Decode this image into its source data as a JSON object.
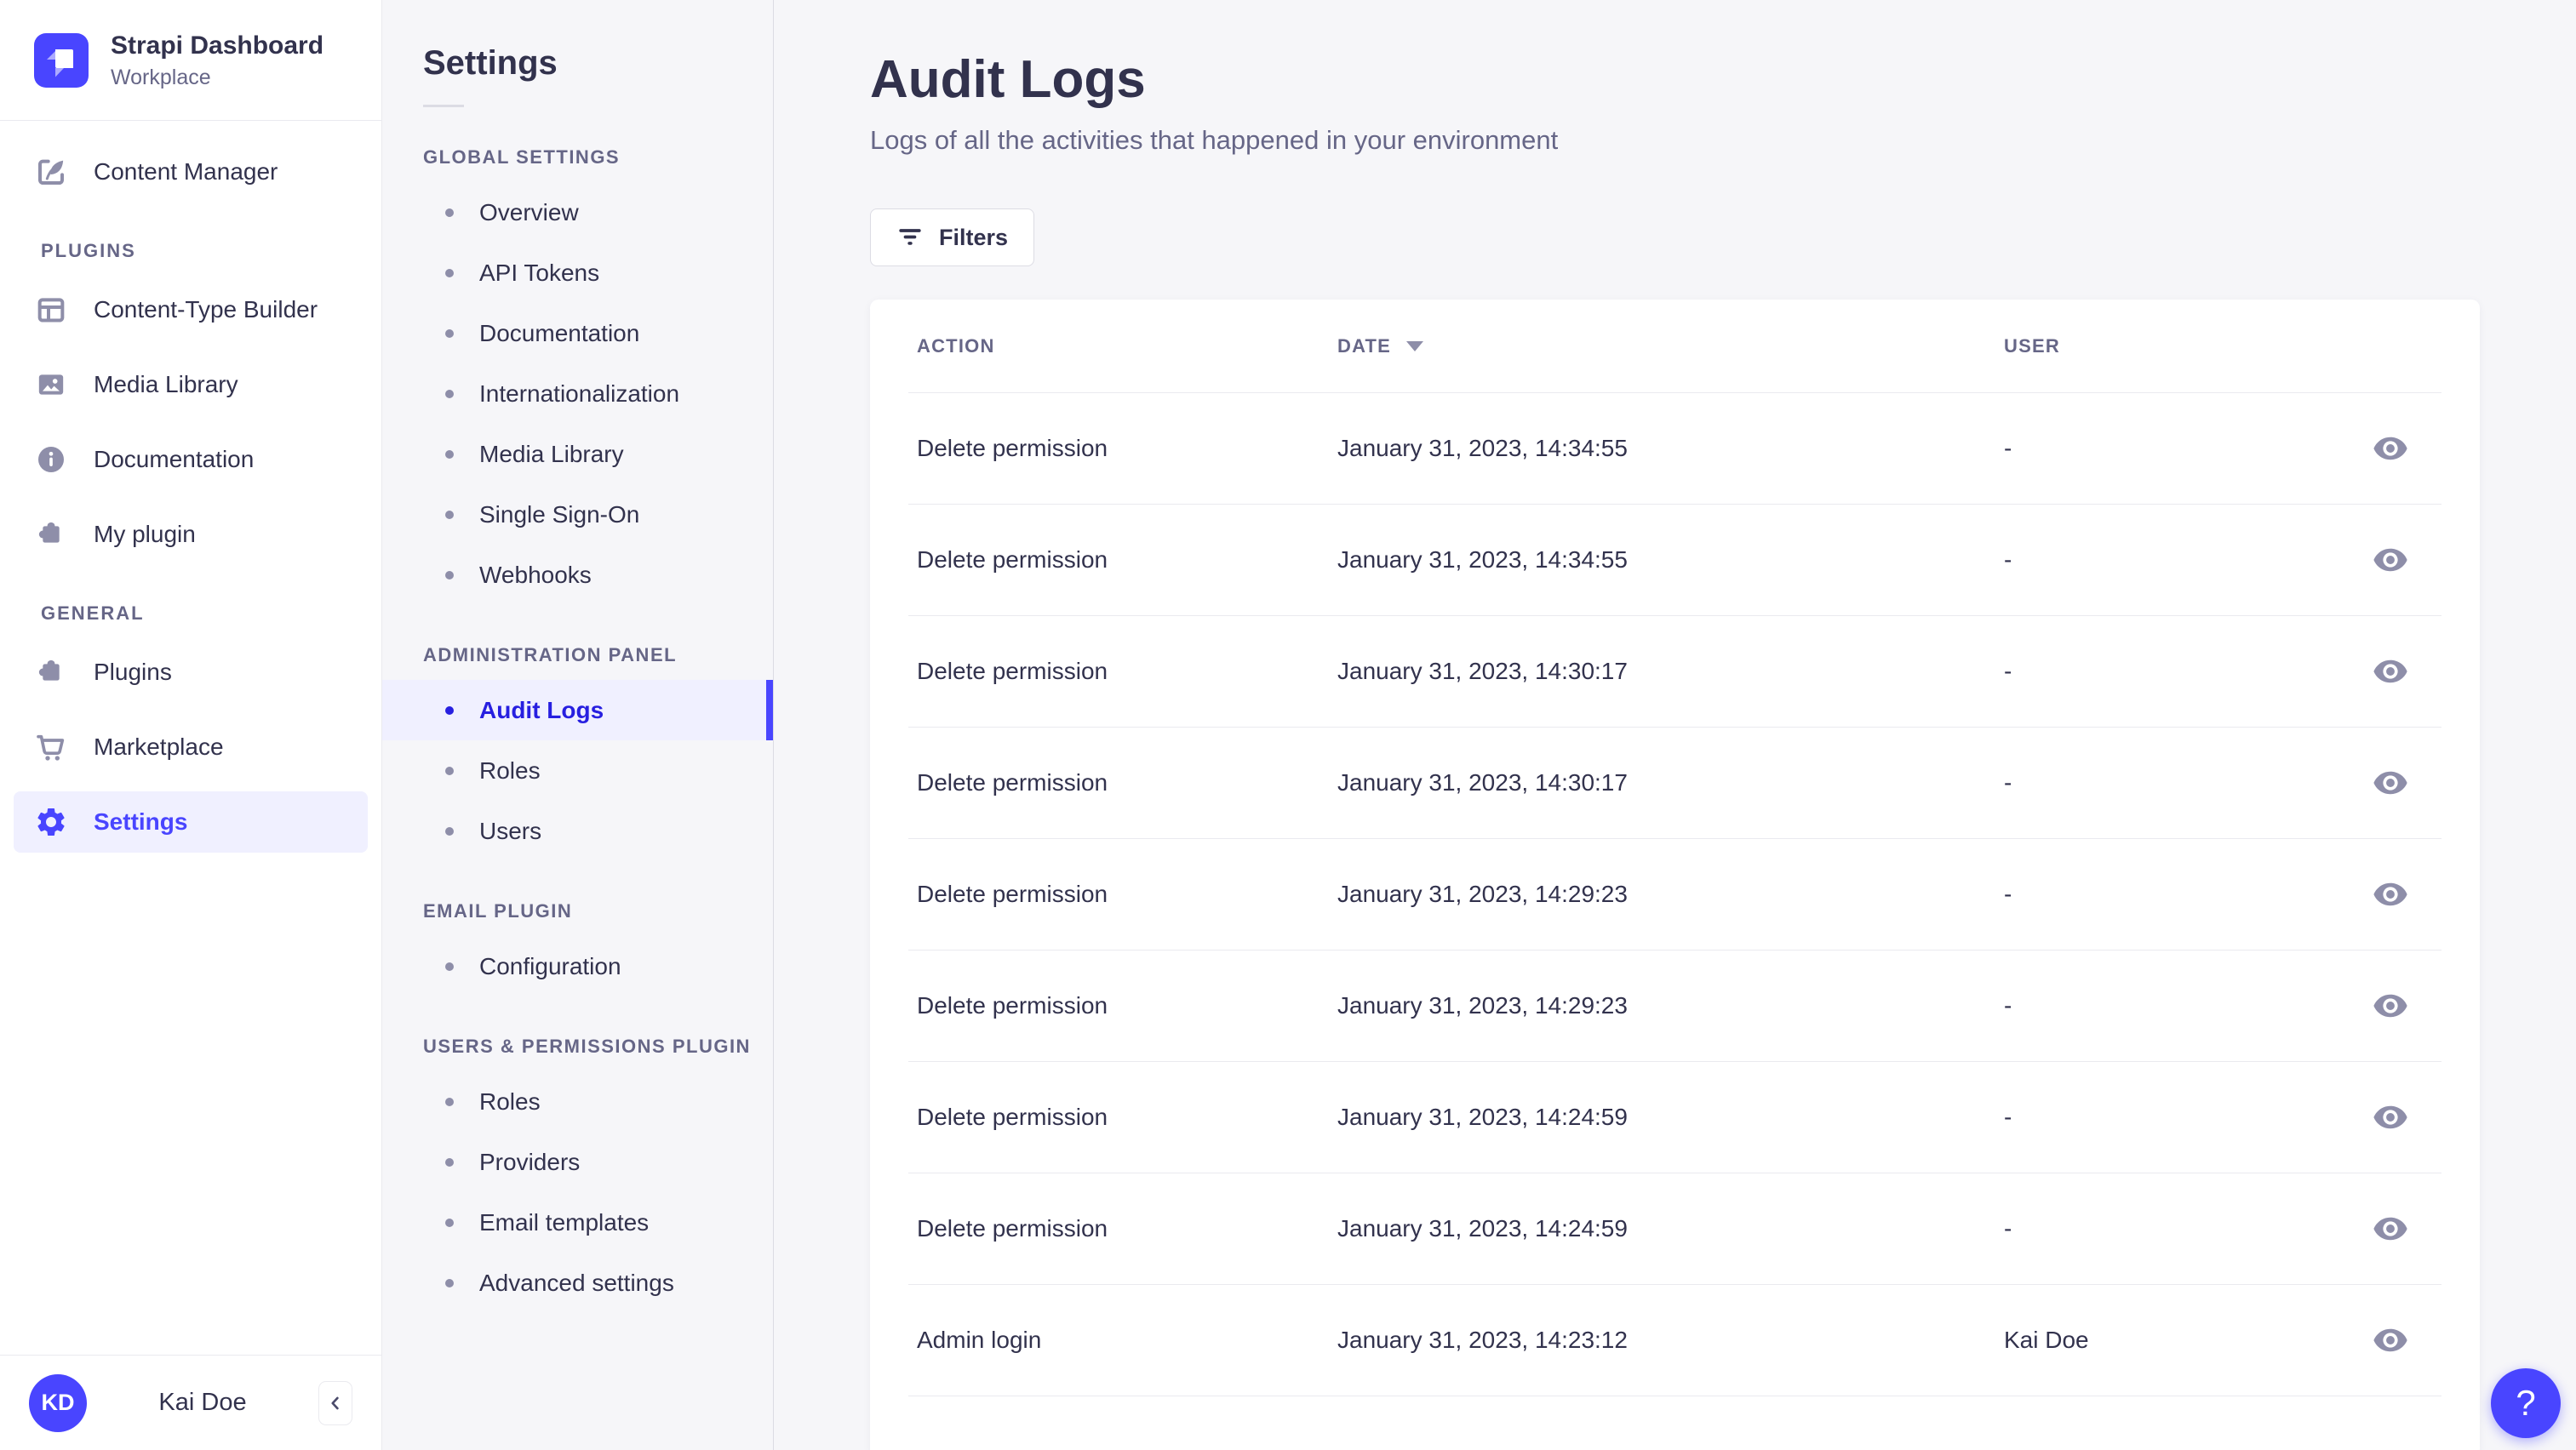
{
  "colors": {
    "primary": "#4945ff",
    "primary_light": "#f0f0ff",
    "active_text": "#271fe0",
    "text_dark": "#32324d",
    "text_muted": "#666687",
    "icon_muted": "#8e8ea9",
    "border": "#eaeaef",
    "surface": "#ffffff",
    "background": "#f6f6f9"
  },
  "brand": {
    "title": "Strapi Dashboard",
    "subtitle": "Workplace"
  },
  "sidebar": {
    "content_manager": {
      "label": "Content Manager"
    },
    "sections": [
      {
        "header": "PLUGINS",
        "items": [
          {
            "label": "Content-Type Builder"
          },
          {
            "label": "Media Library"
          },
          {
            "label": "Documentation"
          },
          {
            "label": "My plugin"
          }
        ]
      },
      {
        "header": "GENERAL",
        "items": [
          {
            "label": "Plugins"
          },
          {
            "label": "Marketplace"
          },
          {
            "label": "Settings",
            "active": true
          }
        ]
      }
    ],
    "footer": {
      "avatar_initials": "KD",
      "user_name": "Kai Doe"
    }
  },
  "subnav": {
    "title": "Settings",
    "sections": [
      {
        "header": "GLOBAL SETTINGS",
        "items": [
          "Overview",
          "API Tokens",
          "Documentation",
          "Internationalization",
          "Media Library",
          "Single Sign-On",
          "Webhooks"
        ]
      },
      {
        "header": "ADMINISTRATION PANEL",
        "active_item": "Audit Logs",
        "items": [
          "Audit Logs",
          "Roles",
          "Users"
        ]
      },
      {
        "header": "EMAIL PLUGIN",
        "items": [
          "Configuration"
        ]
      },
      {
        "header": "USERS & PERMISSIONS PLUGIN",
        "items": [
          "Roles",
          "Providers",
          "Email templates",
          "Advanced settings"
        ]
      }
    ]
  },
  "main": {
    "title": "Audit Logs",
    "subtitle": "Logs of all the activities that happened in your environment",
    "filters_label": "Filters",
    "help_label": "?",
    "table": {
      "columns": [
        "ACTION",
        "DATE",
        "USER"
      ],
      "sorted_column": "DATE",
      "sort_direction": "desc",
      "rows": [
        {
          "action": "Delete permission",
          "date": "January 31, 2023, 14:34:55",
          "user": "-"
        },
        {
          "action": "Delete permission",
          "date": "January 31, 2023, 14:34:55",
          "user": "-"
        },
        {
          "action": "Delete permission",
          "date": "January 31, 2023, 14:30:17",
          "user": "-"
        },
        {
          "action": "Delete permission",
          "date": "January 31, 2023, 14:30:17",
          "user": "-"
        },
        {
          "action": "Delete permission",
          "date": "January 31, 2023, 14:29:23",
          "user": "-"
        },
        {
          "action": "Delete permission",
          "date": "January 31, 2023, 14:29:23",
          "user": "-"
        },
        {
          "action": "Delete permission",
          "date": "January 31, 2023, 14:24:59",
          "user": "-"
        },
        {
          "action": "Delete permission",
          "date": "January 31, 2023, 14:24:59",
          "user": "-"
        },
        {
          "action": "Admin login",
          "date": "January 31, 2023, 14:23:12",
          "user": "Kai Doe"
        }
      ]
    }
  }
}
